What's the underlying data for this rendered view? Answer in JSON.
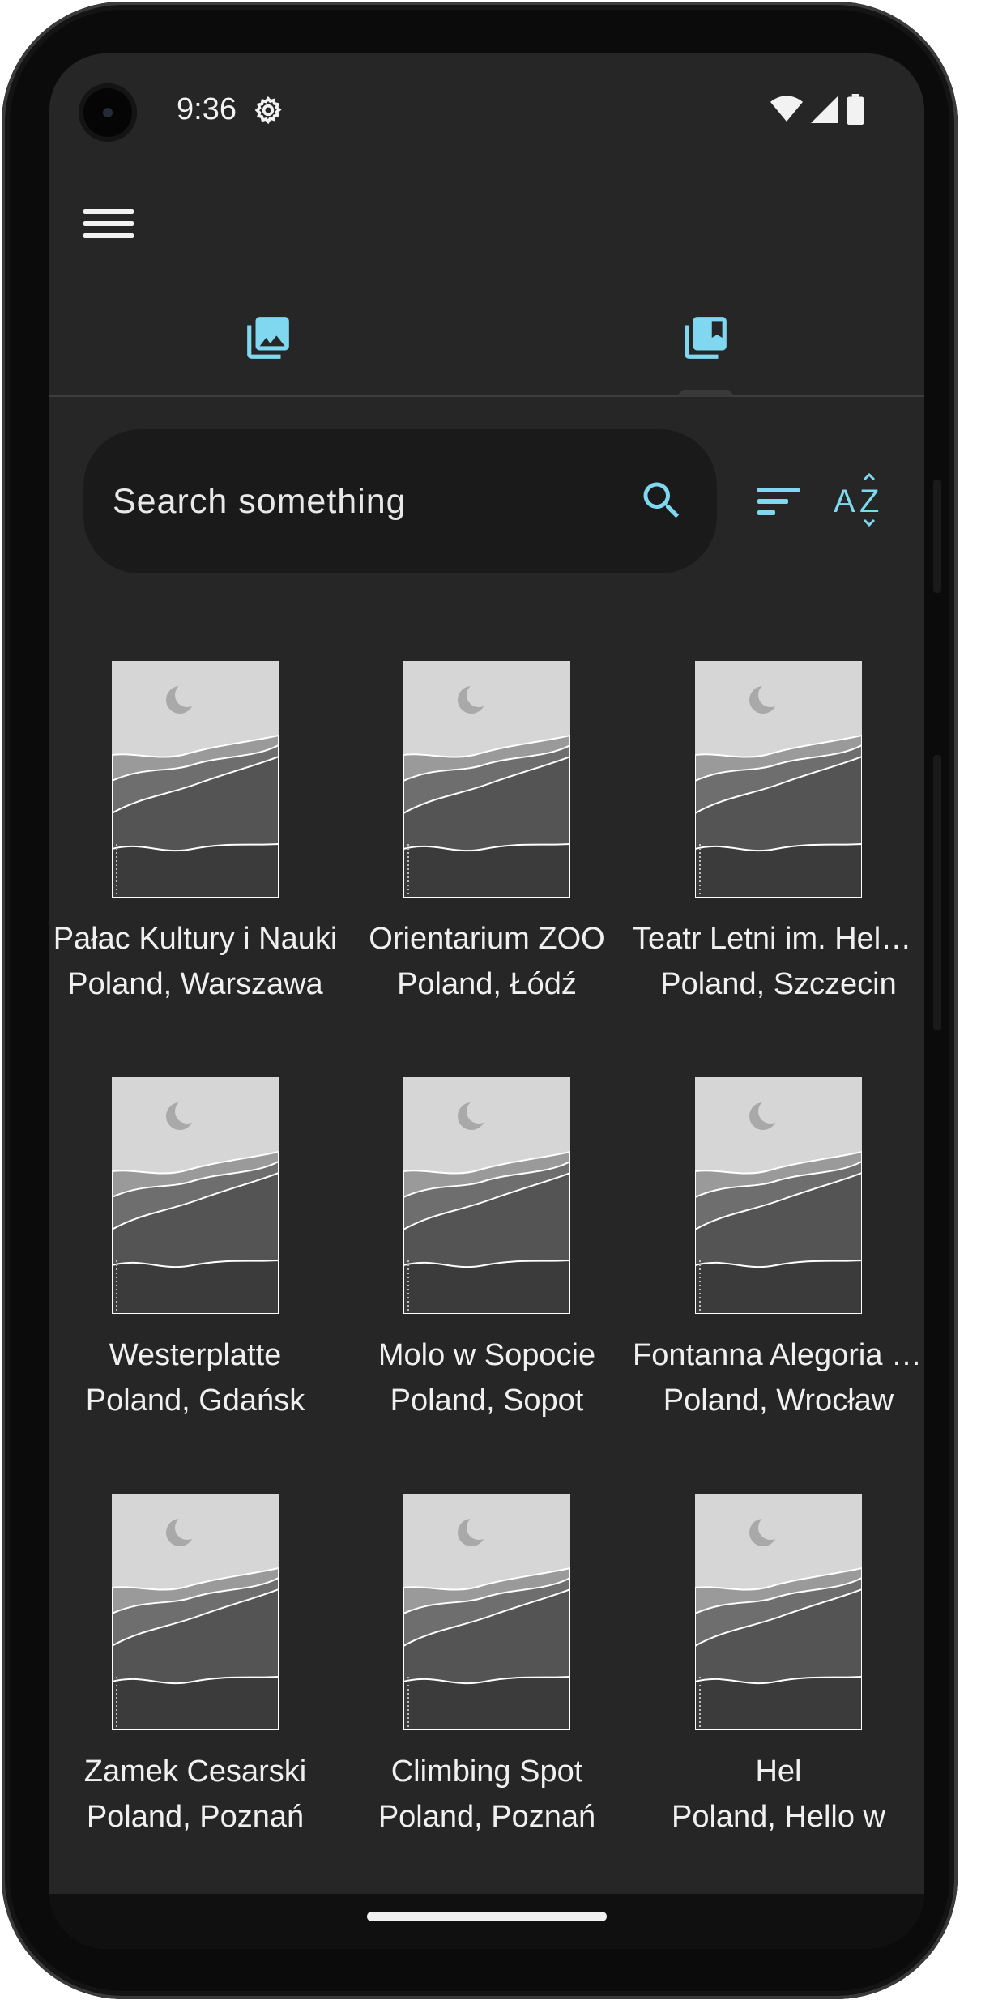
{
  "status_bar": {
    "time": "9:36"
  },
  "colors": {
    "accent": "#7fd8f0",
    "screen_bg": "#262626",
    "search_bg": "#1a1a1a",
    "text": "#f0f0f0"
  },
  "app_bar": {
    "menu_icon": "menu-icon"
  },
  "tabs": [
    {
      "icon": "photo-library-icon",
      "selected": false
    },
    {
      "icon": "collections-bookmark-icon",
      "selected": true
    }
  ],
  "search": {
    "placeholder": "Search something",
    "value": ""
  },
  "places": [
    {
      "title": "Pałac Kultury i Nauki",
      "subtitle": "Poland, Warszawa"
    },
    {
      "title": "Orientarium ZOO",
      "subtitle": "Poland, Łódź"
    },
    {
      "title": "Teatr Letni im. Heleny Majdaniec",
      "subtitle": "Poland, Szczecin"
    },
    {
      "title": "Westerplatte",
      "subtitle": "Poland, Gdańsk"
    },
    {
      "title": "Molo w Sopocie",
      "subtitle": "Poland, Sopot"
    },
    {
      "title": "Fontanna Alegoria Odry",
      "subtitle": "Poland, Wrocław"
    },
    {
      "title": "Zamek Cesarski",
      "subtitle": "Poland, Poznań"
    },
    {
      "title": "Climbing Spot",
      "subtitle": "Poland, Poznań"
    },
    {
      "title": "Hel",
      "subtitle": "Poland, Hello w"
    }
  ]
}
